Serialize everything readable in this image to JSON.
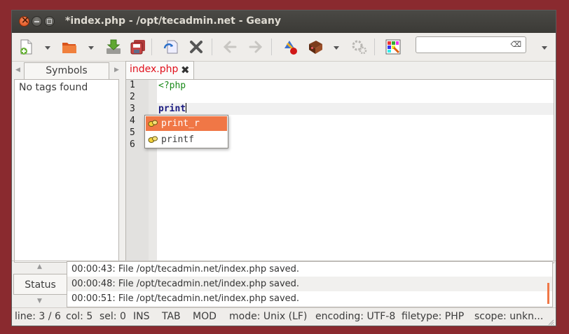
{
  "window": {
    "title": "*index.php - /opt/tecadmin.net - Geany"
  },
  "toolbar": {
    "search_value": "",
    "search_clear_glyph": "⌫",
    "new_icon": "new-file-icon",
    "open_icon": "open-folder-icon",
    "save_icon": "save-icon",
    "save_all_icon": "save-all-icon",
    "reload_icon": "reload-icon",
    "close_icon": "close-file-icon",
    "back_icon": "back-arrow-icon",
    "forward_icon": "forward-arrow-icon",
    "compile_icon": "compile-icon",
    "build_icon": "build-icon",
    "execute_icon": "execute-icon",
    "color_icon": "color-chooser-icon"
  },
  "sidebar": {
    "tab_label": "Symbols",
    "empty_text": "No tags found"
  },
  "editor": {
    "tab_label": "index.php",
    "tab_close_glyph": "✖",
    "line_numbers": [
      "1",
      "2",
      "3",
      "4",
      "5",
      "6"
    ],
    "lines": {
      "l1": "<?php",
      "l3": "print"
    }
  },
  "autocomplete": {
    "items": [
      {
        "label": "print_r",
        "selected": true
      },
      {
        "label": "printf",
        "selected": false
      }
    ]
  },
  "messages": {
    "tab_label": "Status",
    "rows": [
      "00:00:43: File /opt/tecadmin.net/index.php saved.",
      "00:00:48: File /opt/tecadmin.net/index.php saved.",
      "00:00:51: File /opt/tecadmin.net/index.php saved."
    ]
  },
  "statusbar": {
    "line": "line: 3 / 6",
    "col": "col: 5",
    "sel": "sel: 0",
    "ins": "INS",
    "tab": "TAB",
    "mod": "MOD",
    "mode": "mode: Unix (LF)",
    "encoding": "encoding: UTF-8",
    "filetype": "filetype: PHP",
    "scope": "scope: unkn..."
  },
  "colors": {
    "accent": "#f07746",
    "tab_label": "#e0101c",
    "php_tag": "#1a8a1a",
    "keyword": "#1a1a80"
  }
}
